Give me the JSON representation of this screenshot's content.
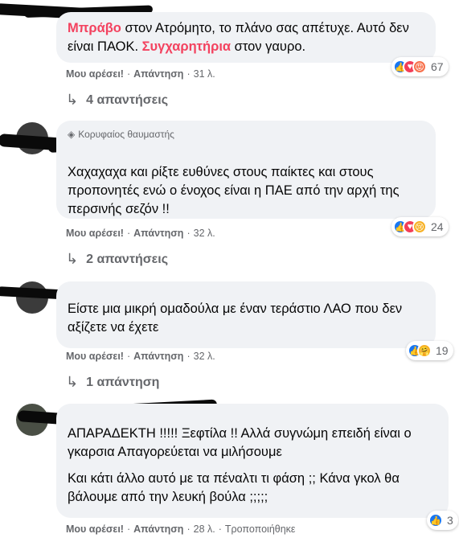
{
  "comments": [
    {
      "paragraphs": [
        [
          {
            "text": "Μπράβο",
            "hl": true
          },
          {
            "text": " στον Ατρόμητο, το πλάνο σας απέτυχε. Αυτό δεν είναι ΠΑΟΚ. ",
            "hl": false
          },
          {
            "text": "Συγχαρητήρια",
            "hl": true
          },
          {
            "text": " στον γαυρο.",
            "hl": false
          }
        ]
      ],
      "meta": {
        "like": "Μου αρέσει!",
        "reply": "Απάντηση",
        "age": "31 λ."
      },
      "reactions": {
        "icons": [
          "like-icon",
          "love-icon",
          "angry-icon"
        ],
        "count": "67"
      },
      "replies": "4 απαντήσεις"
    },
    {
      "badge": "Κορυφαίος θαυμαστής",
      "paragraphs": [
        [
          {
            "text": "Χαχαχαχα και ρίξτε ευθύνες στους παίκτες και στους προπονητές ενώ ο ένοχος είναι η ΠΑΕ από την αρχή της περσινής σεζόν !!",
            "hl": false
          }
        ]
      ],
      "meta": {
        "like": "Μου αρέσει!",
        "reply": "Απάντηση",
        "age": "32 λ."
      },
      "reactions": {
        "icons": [
          "like-icon",
          "love-icon",
          "sad-icon"
        ],
        "count": "24"
      },
      "replies": "2 απαντήσεις"
    },
    {
      "paragraphs": [
        [
          {
            "text": "Είστε μια μικρή ομαδούλα με έναν τεράστιο ΛΑΟ που δεν αξίζετε να έχετε",
            "hl": false
          }
        ]
      ],
      "meta": {
        "like": "Μου αρέσει!",
        "reply": "Απάντηση",
        "age": "32 λ."
      },
      "reactions": {
        "icons": [
          "like-icon",
          "care-icon"
        ],
        "count": "19"
      },
      "replies": "1 απάντηση"
    },
    {
      "paragraphs": [
        [
          {
            "text": "ΑΠΑΡΑΔΕΚΤΗ !!!!! Ξεφτίλα !! Αλλά συγνώμη επειδή είναι ο γκαρσια Απαγορεύεται να μιλήσουμε",
            "hl": false
          }
        ],
        [
          {
            "text": "Και κάτι άλλο αυτό με τα πέναλτι τι φάση ;; Κάνα γκολ θα βάλουμε από την λευκή βούλα ;;;;;",
            "hl": false
          }
        ]
      ],
      "meta": {
        "like": "Μου αρέσει!",
        "reply": "Απάντηση",
        "age": "28 λ.",
        "edited": "Τροποποιήθηκε"
      },
      "reactions": {
        "icons": [
          "like-icon"
        ],
        "count": "3"
      }
    }
  ],
  "colors": {
    "highlight": "#f3425f",
    "like": "#1877f2",
    "love": "#f33e58",
    "bubble": "#f0f2f5",
    "meta": "#65676b"
  }
}
